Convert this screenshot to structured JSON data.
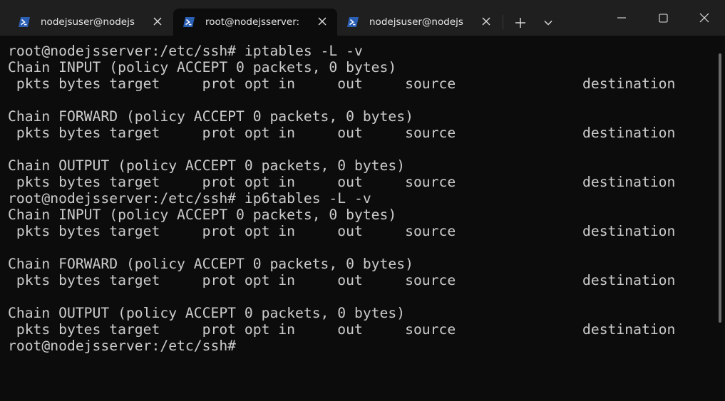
{
  "window": {
    "tabs": [
      {
        "title": "nodejsuser@nodejs",
        "active": false,
        "icon": "powershell-icon"
      },
      {
        "title": "root@nodejsserver:",
        "active": true,
        "icon": "powershell-icon"
      },
      {
        "title": "nodejsuser@nodejs",
        "active": false,
        "icon": "powershell-icon"
      }
    ],
    "controls": {
      "new_tab": "+",
      "dropdown": "chevron-down-icon",
      "minimize": "minimize-icon",
      "maximize": "maximize-icon",
      "close": "close-icon"
    }
  },
  "terminal": {
    "lines": [
      "root@nodejsserver:/etc/ssh# iptables -L -v",
      "Chain INPUT (policy ACCEPT 0 packets, 0 bytes)",
      " pkts bytes target     prot opt in     out     source               destination",
      "",
      "Chain FORWARD (policy ACCEPT 0 packets, 0 bytes)",
      " pkts bytes target     prot opt in     out     source               destination",
      "",
      "Chain OUTPUT (policy ACCEPT 0 packets, 0 bytes)",
      " pkts bytes target     prot opt in     out     source               destination",
      "root@nodejsserver:/etc/ssh# ip6tables -L -v",
      "Chain INPUT (policy ACCEPT 0 packets, 0 bytes)",
      " pkts bytes target     prot opt in     out     source               destination",
      "",
      "Chain FORWARD (policy ACCEPT 0 packets, 0 bytes)",
      " pkts bytes target     prot opt in     out     source               destination",
      "",
      "Chain OUTPUT (policy ACCEPT 0 packets, 0 bytes)",
      " pkts bytes target     prot opt in     out     source               destination",
      "root@nodejsserver:/etc/ssh#"
    ]
  },
  "colors": {
    "background": "#0c0c0c",
    "titlebar": "#1f1f1f",
    "foreground": "#cccccc",
    "powershell_blue": "#2b5fb4"
  }
}
